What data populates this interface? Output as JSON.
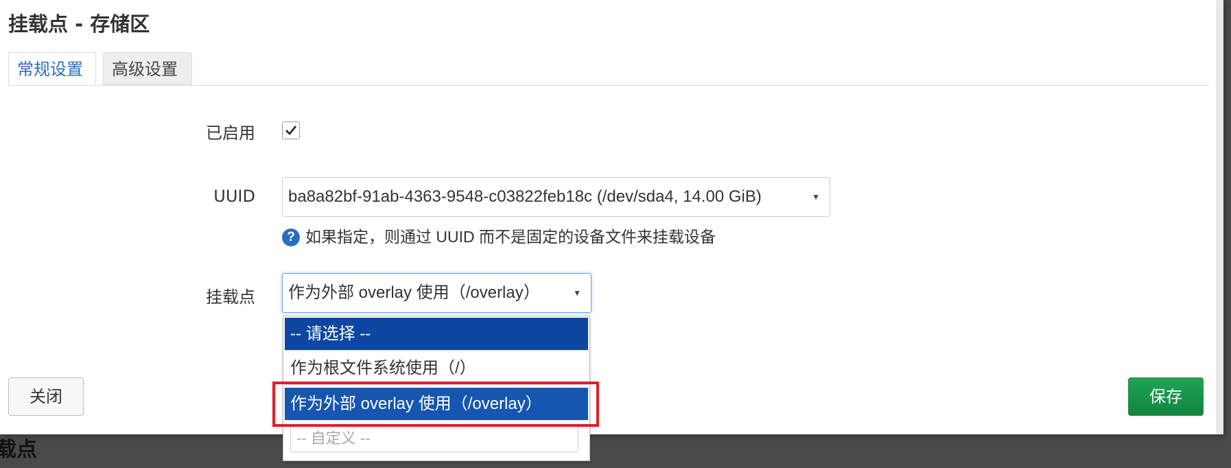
{
  "dialog": {
    "title": "挂载点 - 存储区",
    "background_title": "载点"
  },
  "tabs": [
    {
      "label": "常规设置",
      "active": true
    },
    {
      "label": "高级设置",
      "active": false
    }
  ],
  "fields": {
    "enabled": {
      "label": "已启用",
      "checked": true
    },
    "uuid": {
      "label": "UUID",
      "value": "ba8a82bf-91ab-4363-9548-c03822feb18c (/dev/sda4, 14.00 GiB)",
      "hint": "如果指定，则通过 UUID 而不是固定的设备文件来挂载设备"
    },
    "mountpoint": {
      "label": "挂载点",
      "value": "作为外部 overlay 使用（/overlay）",
      "options": [
        "-- 请选择 --",
        "作为根文件系统使用（/）",
        "作为外部 overlay 使用（/overlay）"
      ],
      "custom_placeholder": "-- 自定义 --"
    }
  },
  "buttons": {
    "close": "关闭",
    "save": "保存"
  },
  "icons": {
    "caret": "▼",
    "help": "?"
  },
  "colors": {
    "accent": "#2a6ebb",
    "option_highlight": "#1556b0",
    "save_button": "#10853f",
    "annotation_box": "#e01e2a"
  }
}
